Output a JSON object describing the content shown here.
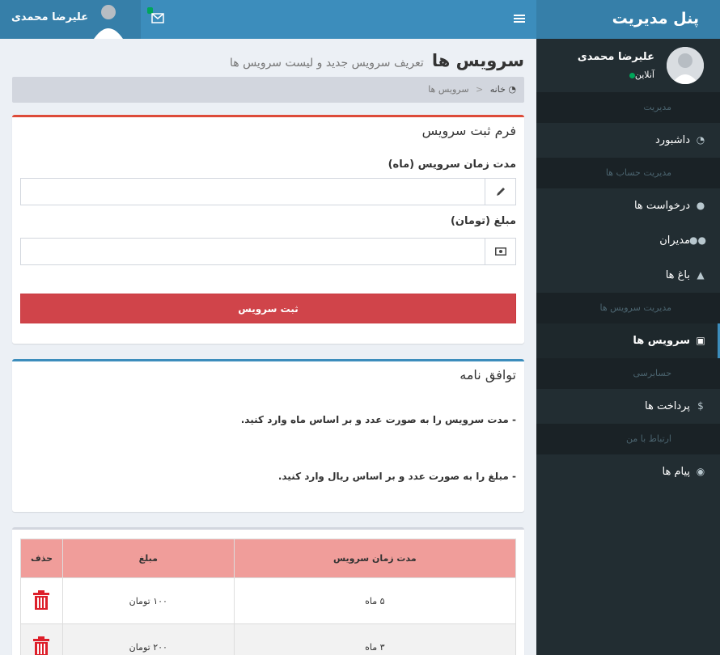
{
  "sidebar": {
    "brand": "پنل مدیریت",
    "user": {
      "name": "علیرضا محمدی",
      "status": "آنلاین"
    },
    "sections": {
      "management": "مدیریت",
      "accounts": "مدیریت حساب ها",
      "services_mgmt": "مدیریت سرویس ها",
      "accounting": "حسابرسی",
      "contact": "ارتباط با من"
    },
    "items": {
      "dashboard": "داشبورد",
      "requests": "درخواست ها",
      "managers": "مدیران",
      "gardens": "باغ ها",
      "services": "سرویس ها",
      "payments": "پرداخت ها",
      "messages": "پیام ها"
    }
  },
  "topbar": {
    "user_name": "علیرضا محمدی"
  },
  "page": {
    "title": "سرویس ها",
    "subtitle": "تعریف سرویس جدید و لیست سرویس ها",
    "breadcrumb": {
      "home": "خانه",
      "current": "سرویس ها"
    }
  },
  "form": {
    "title": "فرم ثبت سرویس",
    "duration_label": "مدت زمان سرویس (ماه)",
    "duration_value": "",
    "price_label": "مبلغ (تومان)",
    "price_value": "",
    "submit_label": "ثبت سرویس"
  },
  "agreement": {
    "title": "توافق نامه",
    "rule1": "- مدت سرویس را به صورت عدد و بر اساس ماه وارد کنید.",
    "rule2": "- مبلغ را به صورت عدد و بر اساس ریال وارد کنید."
  },
  "table": {
    "headers": {
      "duration": "مدت زمان سرویس",
      "price": "مبلغ",
      "delete": "حذف"
    },
    "rows": [
      {
        "duration": "۵ ماه",
        "price": "۱۰۰ تومان"
      },
      {
        "duration": "۳ ماه",
        "price": "۲۰۰ تومان"
      }
    ]
  },
  "colors": {
    "sidebar_bg": "#222d32",
    "header_blue": "#3c8dbc",
    "danger": "#dd4b39",
    "table_header": "#f09d9a",
    "online": "#00a65a"
  },
  "icons": {
    "hamburger": "bars-icon",
    "mail": "envelope-icon",
    "dashboard": "dashboard-icon",
    "requests": "user-icon",
    "managers": "users-icon",
    "gardens": "tree-icon",
    "services": "briefcase-icon",
    "payments": "dollar-icon",
    "messages": "comment-icon",
    "pencil": "pencil-icon",
    "money": "money-icon",
    "trash": "trash-icon"
  }
}
